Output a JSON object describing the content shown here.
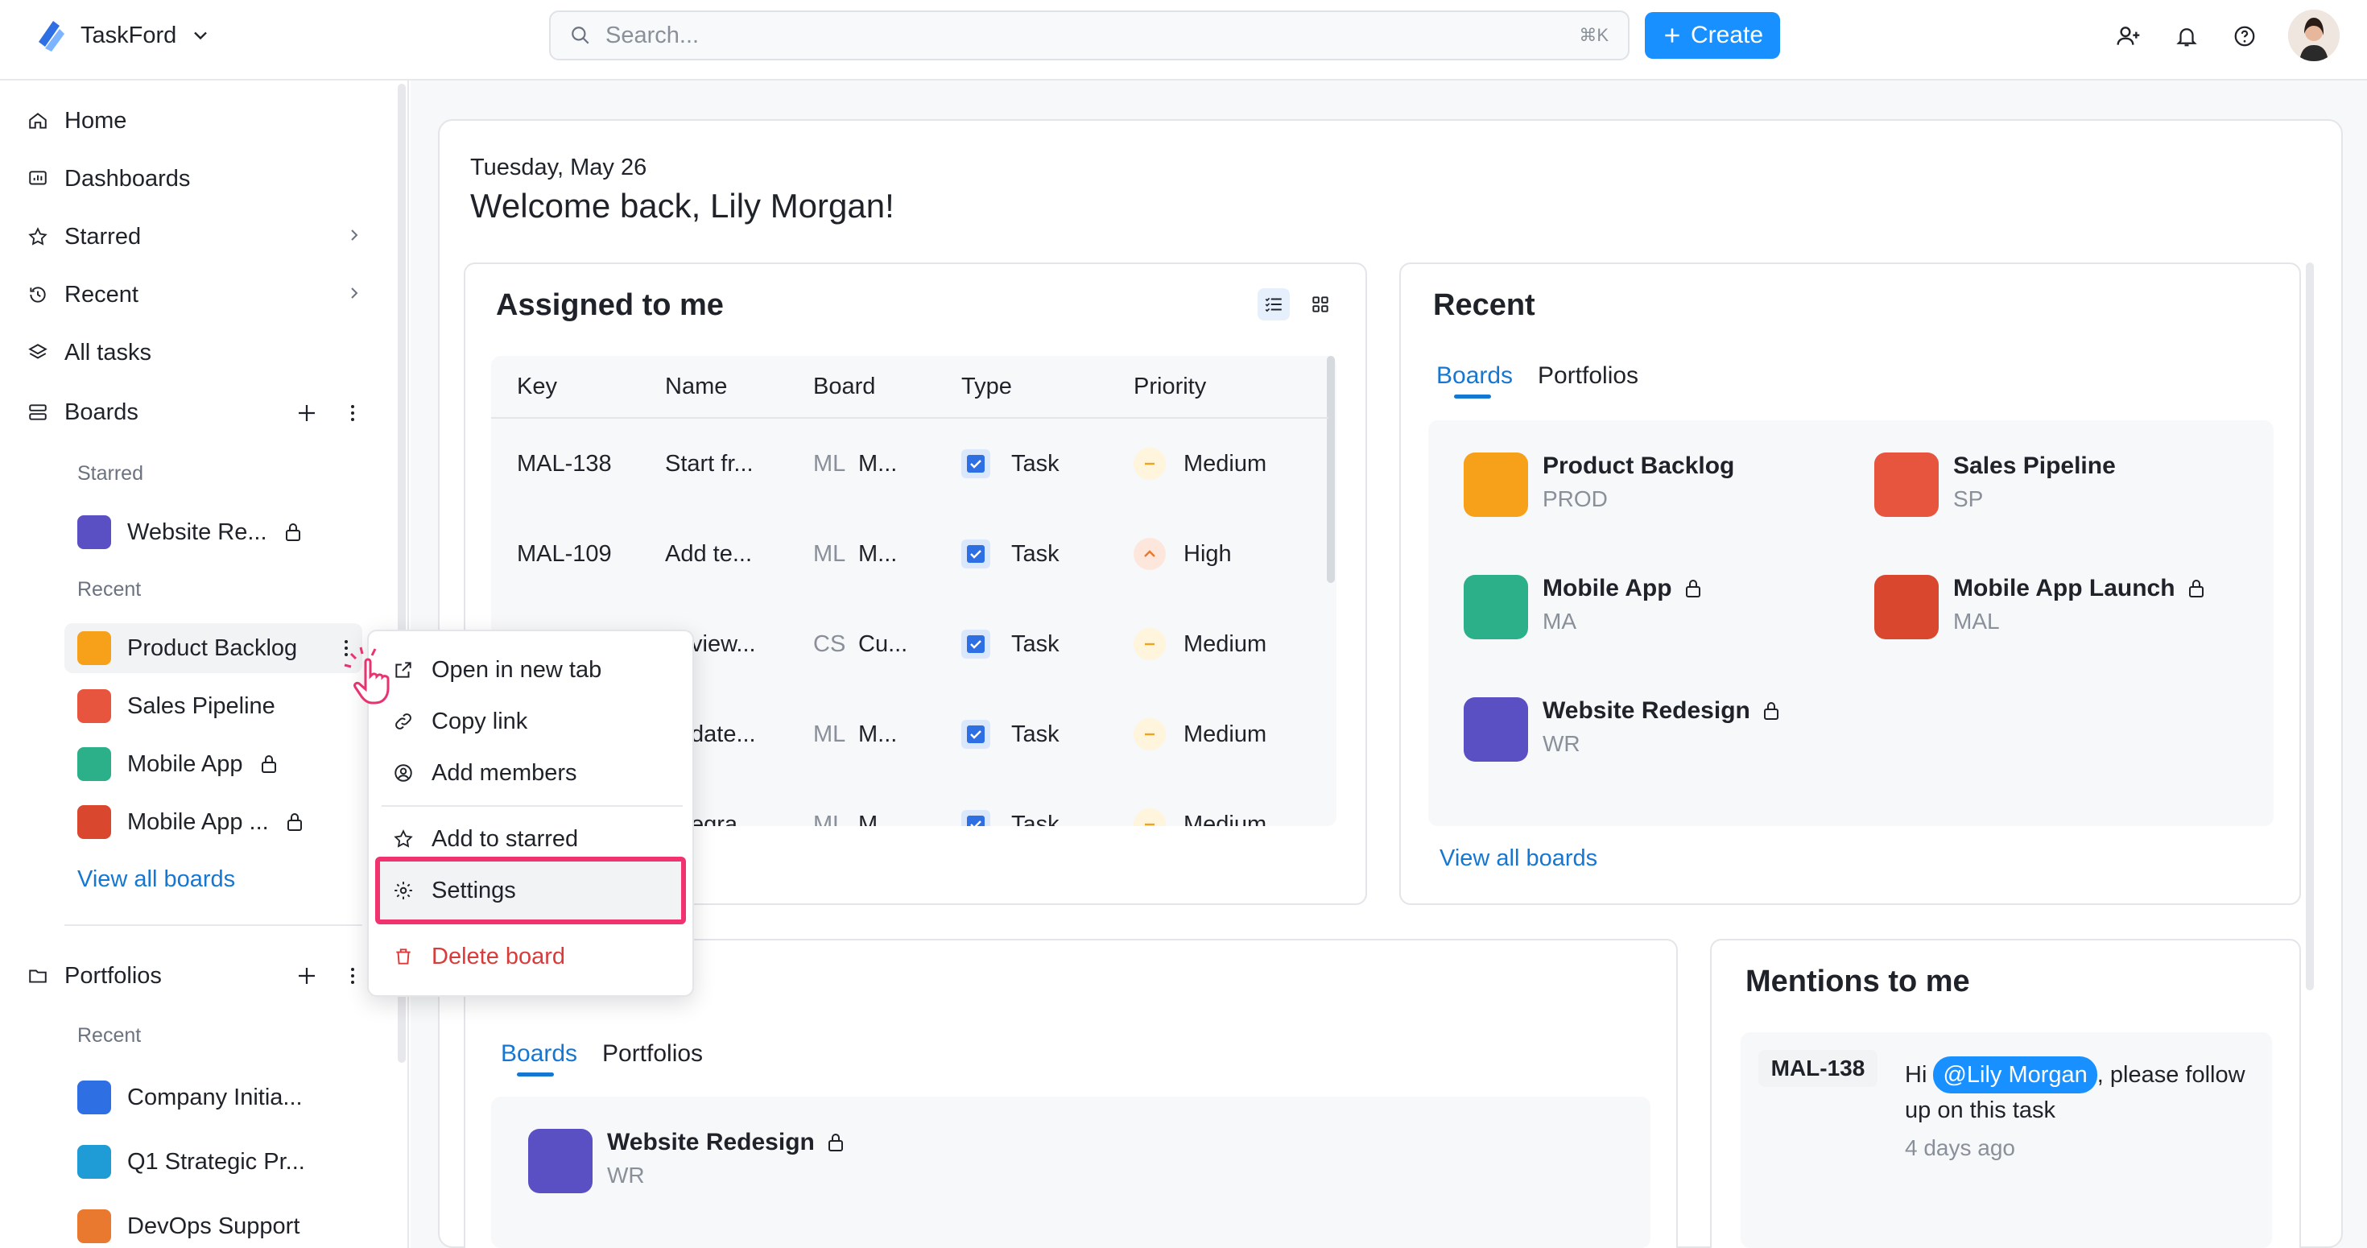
{
  "app": {
    "name": "TaskFord"
  },
  "search": {
    "placeholder": "Search...",
    "shortcut": "⌘K"
  },
  "create_label": "Create",
  "sidebar": {
    "nav": [
      "Home",
      "Dashboards",
      "Starred",
      "Recent",
      "All tasks"
    ],
    "boards_label": "Boards",
    "starred_label": "Starred",
    "starred_boards": [
      {
        "name": "Website Re..."
      }
    ],
    "recent_label": "Recent",
    "recent_boards": [
      {
        "name": "Product Backlog"
      },
      {
        "name": "Sales Pipeline"
      },
      {
        "name": "Mobile App"
      },
      {
        "name": "Mobile App ..."
      }
    ],
    "view_all_boards": "View all boards",
    "portfolios_label": "Portfolios",
    "portfolios_recent_label": "Recent",
    "portfolios": [
      {
        "name": "Company Initia..."
      },
      {
        "name": "Q1 Strategic Pr..."
      },
      {
        "name": "DevOps Support"
      }
    ]
  },
  "greeting": {
    "date": "Tuesday, May 26",
    "welcome": "Welcome back, Lily Morgan!"
  },
  "assigned": {
    "title": "Assigned to me",
    "columns": [
      "Key",
      "Name",
      "Board",
      "Type",
      "Priority"
    ],
    "rows": [
      {
        "key": "MAL-138",
        "name": "Start fr...",
        "board_code": "ML",
        "board": "M...",
        "type": "Task",
        "priority": "Medium"
      },
      {
        "key": "MAL-109",
        "name": "Add te...",
        "board_code": "ML",
        "board": "M...",
        "type": "Task",
        "priority": "High"
      },
      {
        "key": "",
        "name": "view...",
        "board_code": "CS",
        "board": "Cu...",
        "type": "Task",
        "priority": "Medium"
      },
      {
        "key": "",
        "name": "date...",
        "board_code": "ML",
        "board": "M...",
        "type": "Task",
        "priority": "Medium"
      },
      {
        "key": "",
        "name": "egra...",
        "board_code": "ML",
        "board": "M...",
        "type": "Task",
        "priority": "Medium"
      }
    ]
  },
  "recent": {
    "title": "Recent",
    "tabs": [
      "Boards",
      "Portfolios"
    ],
    "items": [
      {
        "name": "Product Backlog",
        "key": "PROD"
      },
      {
        "name": "Sales Pipeline",
        "key": "SP"
      },
      {
        "name": "Mobile App",
        "key": "MA"
      },
      {
        "name": "Mobile App Launch",
        "key": "MAL"
      },
      {
        "name": "Website Redesign",
        "key": "WR"
      }
    ],
    "view_all": "View all boards"
  },
  "starred_card": {
    "tabs": [
      "Boards",
      "Portfolios"
    ],
    "item": {
      "name": "Website Redesign",
      "key": "WR"
    }
  },
  "mentions": {
    "title": "Mentions to me",
    "key": "MAL-138",
    "text_pre": "Hi ",
    "tag": "@Lily Morgan",
    "text_post": ", please follow",
    "text_line2": "up on this task",
    "time": "4 days ago"
  },
  "context_menu": {
    "items": [
      "Open in new tab",
      "Copy link",
      "Add members",
      "Add to starred",
      "Settings",
      "Delete board"
    ]
  },
  "colors": {
    "accent": "#1890ff",
    "highlight": "#f0336f",
    "danger": "#d93a3a"
  }
}
